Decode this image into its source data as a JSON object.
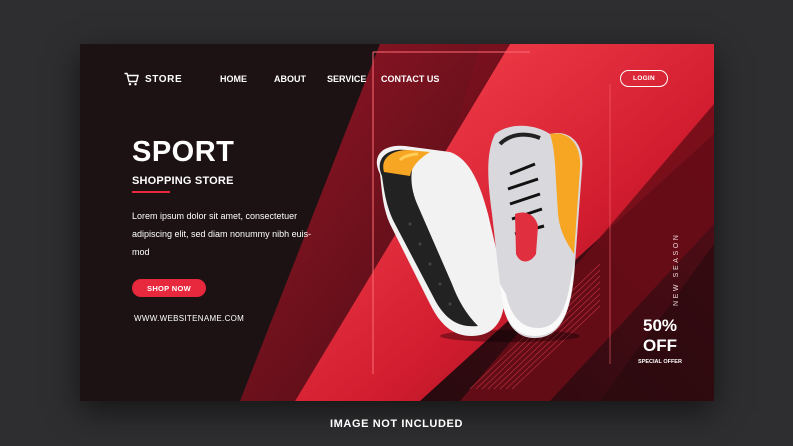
{
  "brand": {
    "name": "STORE",
    "icon": "cart-icon"
  },
  "nav": {
    "items": [
      "HOME",
      "ABOUT",
      "SERVICE",
      "CONTACT US"
    ]
  },
  "login": {
    "label": "LOGIN"
  },
  "hero": {
    "title": "SPORT",
    "subtitle": "SHOPPING STORE",
    "description_lines": [
      "Lorem ipsum dolor sit amet, consectetuer",
      "adipiscing elit, sed diam nonummy nibh euis-",
      "mod"
    ],
    "cta": "SHOP NOW",
    "website": "WWW.WEBSITENAME.COM"
  },
  "side": {
    "vertical_label": "NEW SEASON",
    "discount": "50%",
    "discount_word": "OFF",
    "discount_caption": "SPECIAL OFFER"
  },
  "footer": {
    "note": "IMAGE NOT INCLUDED"
  },
  "colors": {
    "accent": "#e8283c",
    "dark": "#1c1214",
    "outer": "#2e2e30"
  }
}
